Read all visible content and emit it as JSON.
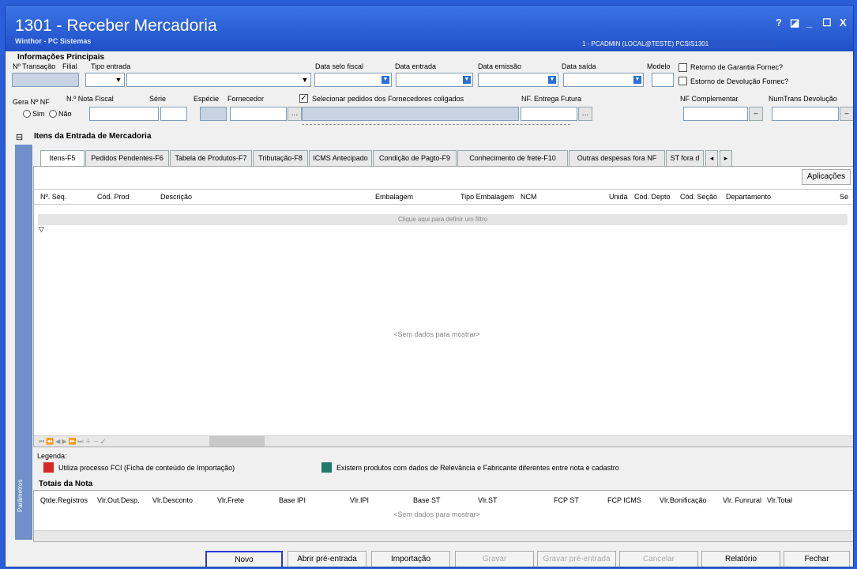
{
  "title": {
    "main": "1301 - Receber Mercadoria",
    "sub": "Winthor - PC Sistemas",
    "user": "1 - PCADMIN (LOCAL@TESTE)  PCSIS1301"
  },
  "controls": [
    "?",
    "◪",
    "_",
    "☐",
    "X"
  ],
  "info": {
    "section": "Informações Principais",
    "labels": {
      "transacao": "Nº Transação",
      "filial": "Filial",
      "tipo_entrada": "Tipo entrada",
      "data_selo": "Data selo fiscal",
      "data_entrada": "Data entrada",
      "data_emissao": "Data emissão",
      "data_saida": "Data saída",
      "modelo": "Modelo",
      "retorno": "Retorno de Garantia Fornec?",
      "estorno": "Estorno de Devolução Fornec?",
      "gera_nf": "Gera Nº NF",
      "sim": "Sim",
      "nao": "Não",
      "nota": "N.º Nota Fiscal",
      "serie": "Série",
      "especie": "Espécie",
      "fornecedor": "Fornecedor",
      "sel_pedidos": "Selecionar pedidos dos Fornecedores coligados",
      "nf_futura": "NF. Entrega Futura",
      "nf_compl": "NF Complementar",
      "numtrans": "NumTrans Devolução"
    }
  },
  "items": {
    "section": "Itens da Entrada de Mercadoria",
    "tabs": [
      "Itens-F5",
      "Pedidos Pendentes-F6",
      "Tabela de Produtos-F7",
      "Tributação-F8",
      "ICMS Antecipado",
      "Condição de Pagto-F9",
      "Conhecimento de frete-F10",
      "Outras despesas fora NF",
      "ST fora d"
    ],
    "aplicacoes": "Aplicações",
    "columns": [
      "Nº. Seq.",
      "Cód. Prod",
      "Descrição",
      "Embalagem",
      "Tipo Embalagem",
      "NCM",
      "Unida",
      "Cód. Depto",
      "Cód. Seção",
      "Departamento",
      "Se"
    ],
    "filter": "Clique aqui para definir um filtro",
    "empty": "<Sem dados para mostrar>"
  },
  "legend": {
    "title": "Legenda:",
    "red": "Utiliza processo FCI (Ficha de conteúdo de Importação)",
    "green": "Existem produtos com dados de Relevância e Fabricante diferentes entre nota e cadastro",
    "red_color": "#d42828",
    "green_color": "#1f7a6a"
  },
  "totais": {
    "section": "Totais da Nota",
    "columns": [
      "Qtde.Registros",
      "Vlr.Out.Desp.",
      "Vlr.Desconto",
      "Vlr.Frete",
      "Base IPI",
      "Vlr.IPI",
      "Base ST",
      "Vlr.ST",
      "FCP ST",
      "FCP ICMS",
      "Vlr.Bonificação",
      "Vlr. Funrural",
      "Vlr.Total"
    ],
    "empty": "<Sem dados para mostrar>"
  },
  "side": "Parâmetros",
  "buttons": {
    "novo": "Novo",
    "abrir": "Abrir pré-entrada",
    "importacao": "Importação",
    "gravar": "Gravar",
    "gravar_pre": "Gravar pré-entrada",
    "cancelar": "Cancelar",
    "relatorio": "Relatório",
    "fechar": "Fechar"
  }
}
